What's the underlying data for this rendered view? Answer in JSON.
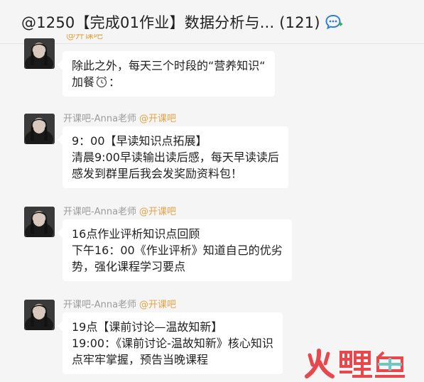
{
  "header": {
    "title": "@1250【完成01作业】数据分析与... (121)",
    "icon": "chat-bubble-icon"
  },
  "messages": [
    {
      "sender": "",
      "tag": "@开课吧",
      "lines": [
        "除此之外，每天三个时段的“营养知识“",
        "加餐",
        "："
      ]
    },
    {
      "sender": "开课吧-Anna老师",
      "tag": "@开课吧",
      "lines": [
        "9：00【早读知识点拓展】",
        "清晨9:00早读输出读后感，每天早读读后",
        "感发到群里后我会发奖励资料包！"
      ]
    },
    {
      "sender": "开课吧-Anna老师",
      "tag": "@开课吧",
      "lines": [
        "16点作业评析知识点回顾",
        "下午16：00《作业评析》知道自己的优劣",
        "势，强化课程学习要点"
      ]
    },
    {
      "sender": "开课吧-Anna老师",
      "tag": "@开课吧",
      "lines": [
        "19点【课前讨论—温故知新】",
        "19:00：《课前讨论-温故知新》核心知识",
        "点牢牢掌握，预告当晚课程"
      ]
    }
  ],
  "watermark": {
    "text": "火鲤鱼",
    "colors": {
      "primary": "#e8474d",
      "secondary": "#6fc7c2"
    }
  },
  "colors": {
    "background": "#f5f5f5",
    "bubble": "#ffffff",
    "sender": "#9b9b9b",
    "tag": "#e4a343",
    "text": "#1f1f1f"
  }
}
